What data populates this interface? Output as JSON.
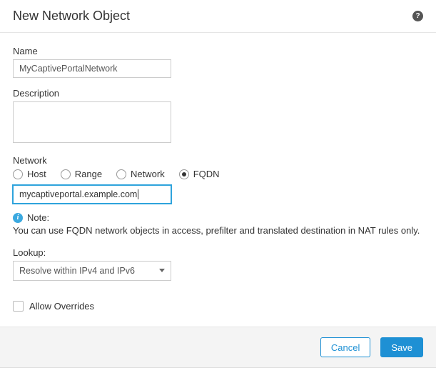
{
  "header": {
    "title": "New Network Object"
  },
  "name": {
    "label": "Name",
    "value": "MyCaptivePortalNetwork"
  },
  "description": {
    "label": "Description",
    "value": ""
  },
  "network": {
    "label": "Network",
    "options": {
      "host": "Host",
      "range": "Range",
      "network": "Network",
      "fqdn": "FQDN"
    },
    "selected": "fqdn",
    "value": "mycaptiveportal.example.com"
  },
  "note": {
    "label": "Note:",
    "text": "You can use FQDN network objects in access, prefilter and translated destination in NAT rules only."
  },
  "lookup": {
    "label": "Lookup:",
    "selected": "Resolve within IPv4 and IPv6"
  },
  "overrides": {
    "label": "Allow Overrides",
    "checked": false
  },
  "footer": {
    "cancel": "Cancel",
    "save": "Save"
  }
}
